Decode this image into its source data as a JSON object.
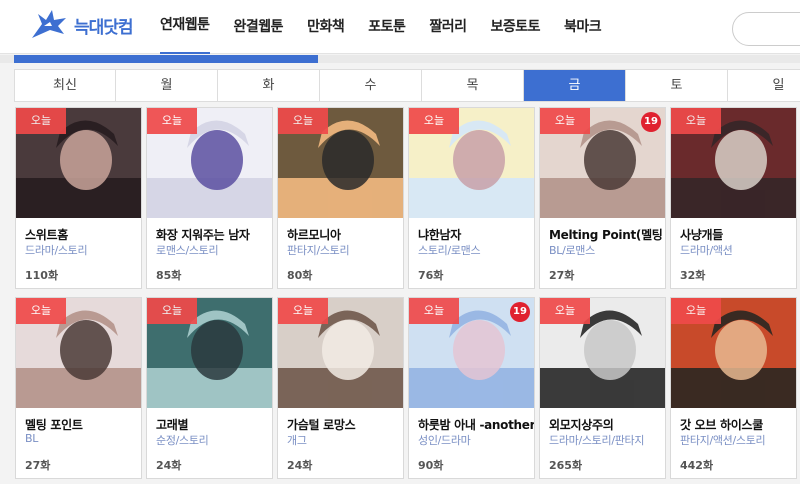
{
  "site": {
    "logo_text": "늑대닷컴"
  },
  "nav": [
    "연재웹툰",
    "완결웹툰",
    "만화책",
    "포토툰",
    "짤러리",
    "보증토토",
    "북마크"
  ],
  "nav_active": 0,
  "progress_fraction": 0.38,
  "day_tabs": [
    "최신",
    "월",
    "화",
    "수",
    "목",
    "금",
    "토",
    "일"
  ],
  "day_tab_active": 5,
  "badges": {
    "today": "오늘",
    "adult": "19"
  },
  "comics": [
    {
      "title": "스위트홈",
      "genre": "드라마/스토리",
      "episodes": "110화",
      "adult": false,
      "palette": [
        "#4a3a3c",
        "#2a1f22",
        "#c9a59a"
      ]
    },
    {
      "title": "화장 지워주는 남자",
      "genre": "로맨스/스토리",
      "episodes": "85화",
      "adult": false,
      "palette": [
        "#efeff6",
        "#d6d6e6",
        "#5a4fa0"
      ]
    },
    {
      "title": "하르모니아",
      "genre": "판타지/스토리",
      "episodes": "80화",
      "adult": false,
      "palette": [
        "#6e5a3e",
        "#e5b07a",
        "#2a2a2a"
      ]
    },
    {
      "title": "냐한남자",
      "genre": "스토리/로맨스",
      "episodes": "76화",
      "adult": false,
      "palette": [
        "#f6f0c8",
        "#d8e8f4",
        "#c8a0a8"
      ]
    },
    {
      "title": "Melting Point(멜팅 포",
      "genre": "BL/로맨스",
      "episodes": "27화",
      "adult": true,
      "palette": [
        "#e4d6cf",
        "#b89b92",
        "#4a3a36"
      ]
    },
    {
      "title": "사냥개들",
      "genre": "드라마/액션",
      "episodes": "32화",
      "adult": false,
      "palette": [
        "#6a2a2c",
        "#3a2628",
        "#d8d0c8"
      ]
    },
    {
      "title": "멜팅 포인트",
      "genre": "BL",
      "episodes": "27화",
      "adult": false,
      "palette": [
        "#e6dada",
        "#b99a92",
        "#4a3a36"
      ]
    },
    {
      "title": "고래별",
      "genre": "순정/스토리",
      "episodes": "24화",
      "adult": false,
      "palette": [
        "#3e6e6e",
        "#9fc4c4",
        "#2a3a3e"
      ]
    },
    {
      "title": "가슴털 로망스",
      "genre": "개그",
      "episodes": "24화",
      "adult": false,
      "palette": [
        "#d8cfc8",
        "#7a6458",
        "#f2ebe4"
      ]
    },
    {
      "title": "하룻밤 아내 -another",
      "genre": "성인/드라마",
      "episodes": "90화",
      "adult": true,
      "palette": [
        "#cfe0f2",
        "#9ab8e4",
        "#e4c4d4"
      ]
    },
    {
      "title": "외모지상주의",
      "genre": "드라마/스토리/판타지",
      "episodes": "265화",
      "adult": false,
      "palette": [
        "#ebebeb",
        "#3a3a3a",
        "#c8c8c8"
      ]
    },
    {
      "title": "갓 오브 하이스쿨",
      "genre": "판타지/액션/스토리",
      "episodes": "442화",
      "adult": false,
      "palette": [
        "#c84a2a",
        "#3a2a22",
        "#e8b890"
      ]
    }
  ]
}
